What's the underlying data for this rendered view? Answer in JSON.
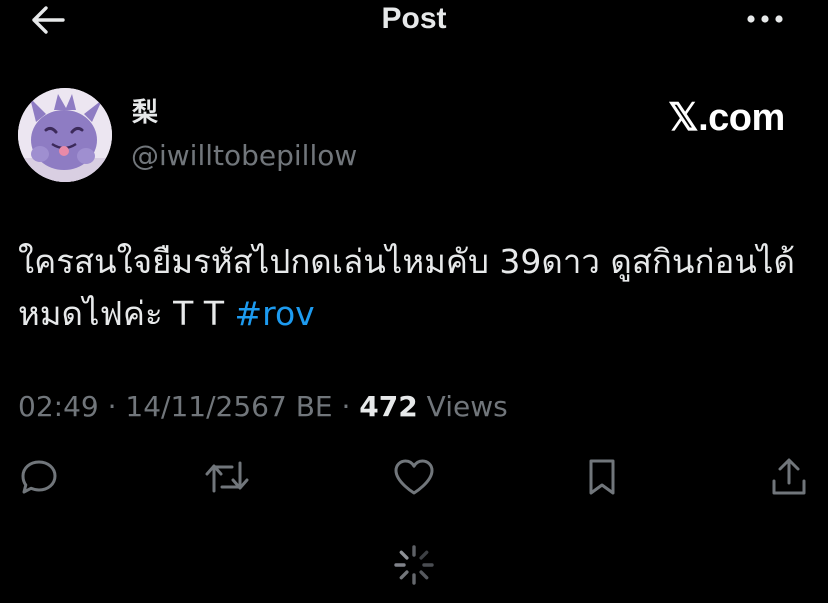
{
  "header": {
    "title": "Post",
    "back_icon": "arrow-left-icon",
    "more_icon": "more-horizontal-icon"
  },
  "author": {
    "display_name": "梨",
    "handle": "@iwilltobepillow",
    "avatar_icon": "gengar-avatar"
  },
  "watermark": "𝕏.com",
  "tweet": {
    "text_before_hashtag": "ใครสนใจยืมรหัสไปกดเล่นไหมคับ 39ดาว ดูสกินก่อนได้ หมดไฟค่ะ T T ",
    "hashtag": "#rov"
  },
  "meta": {
    "time": "02:49",
    "separator_1": " · ",
    "date": "14/11/2567 BE",
    "separator_2": " · ",
    "views_count": "472",
    "views_label": " Views"
  },
  "actions": [
    {
      "name": "reply",
      "icon": "reply-icon"
    },
    {
      "name": "repost",
      "icon": "repost-icon"
    },
    {
      "name": "like",
      "icon": "heart-icon"
    },
    {
      "name": "bookmark",
      "icon": "bookmark-icon"
    },
    {
      "name": "share",
      "icon": "share-icon"
    }
  ],
  "colors": {
    "background": "#000000",
    "primary_text": "#e7e9ea",
    "secondary_text": "#71767b",
    "link": "#1d9bf0",
    "avatar_purple": "#8e7cc3"
  }
}
